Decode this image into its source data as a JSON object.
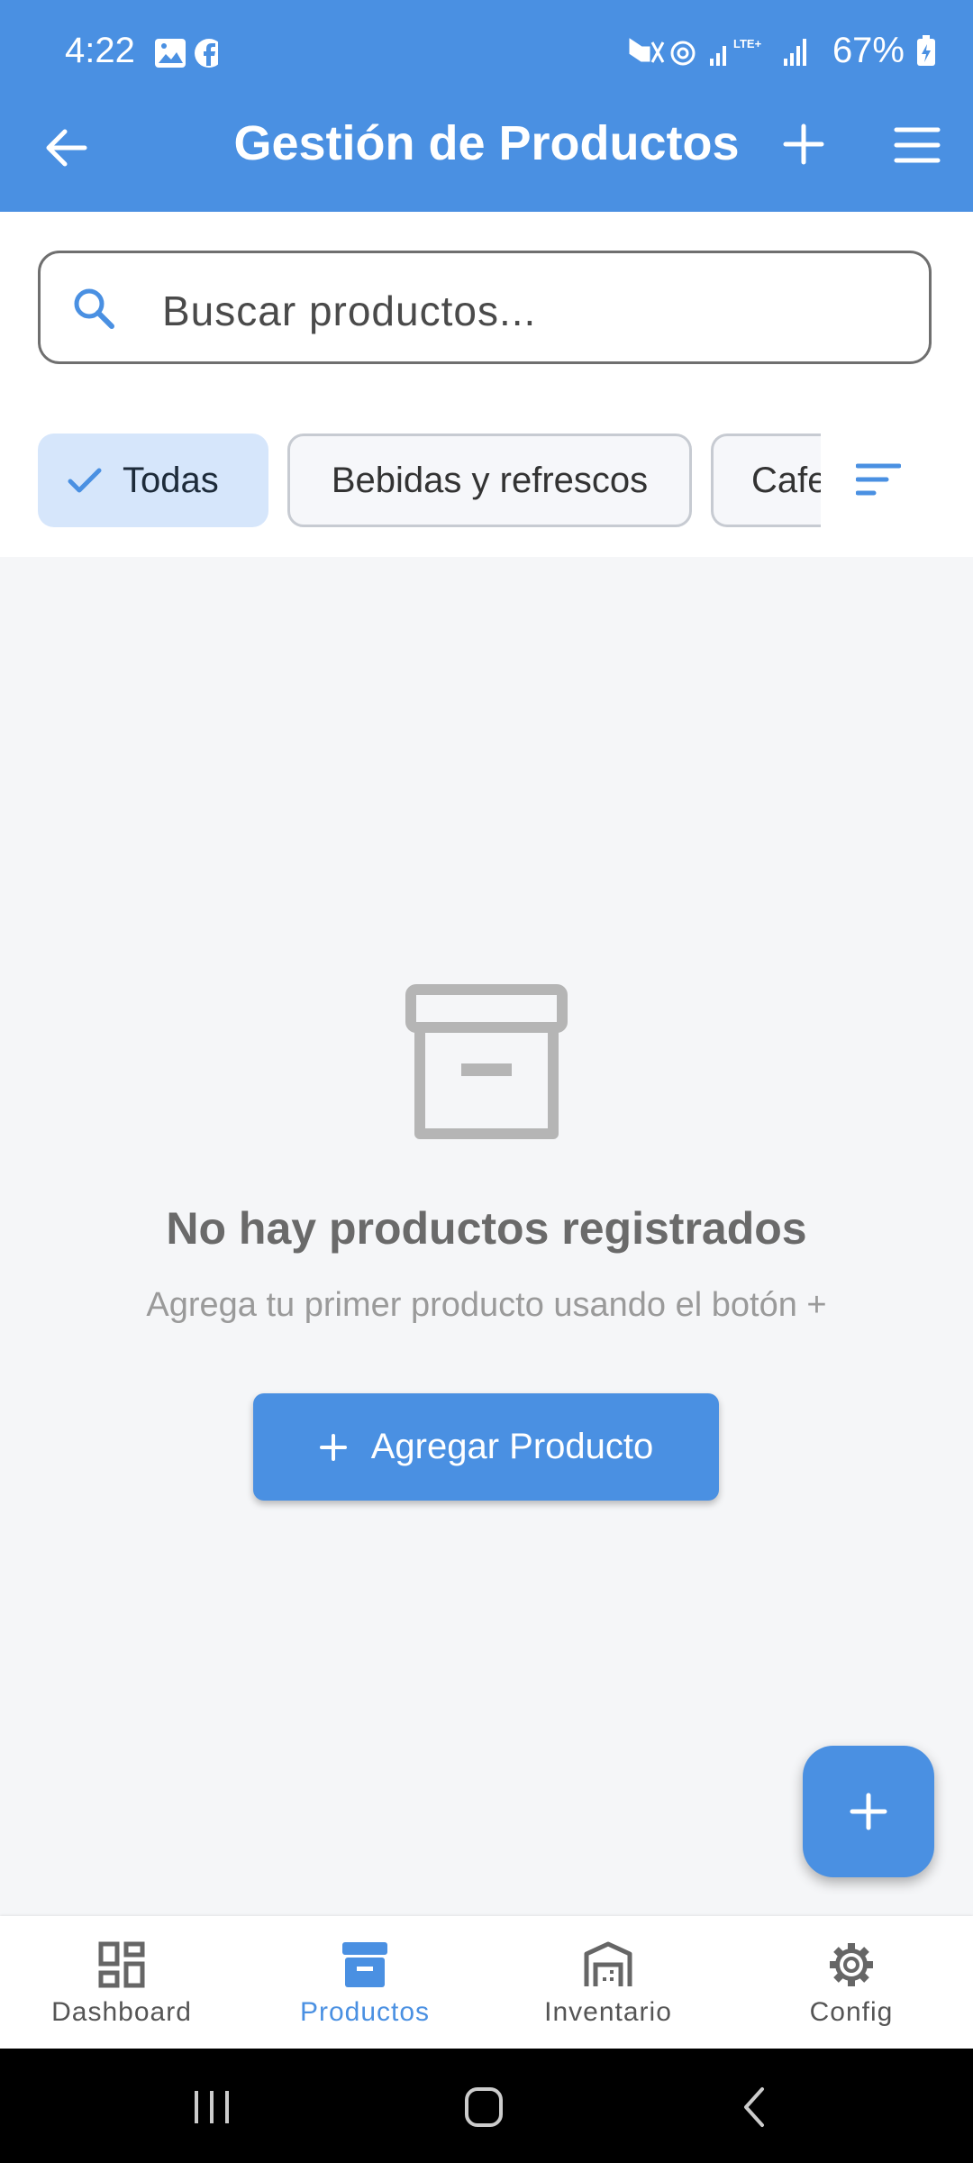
{
  "status_bar": {
    "time": "4:22",
    "battery": "67%"
  },
  "header": {
    "title": "Gestión de Productos"
  },
  "search": {
    "placeholder": "Buscar productos..."
  },
  "chips": [
    {
      "label": "Todas",
      "selected": true
    },
    {
      "label": "Bebidas y refrescos",
      "selected": false
    },
    {
      "label": "Cafe",
      "selected": false
    }
  ],
  "empty_state": {
    "title": "No hay productos registrados",
    "subtitle": "Agrega tu primer producto usando el botón +",
    "button_label": "Agregar Producto"
  },
  "bottom_nav": [
    {
      "label": "Dashboard",
      "icon": "dashboard-icon",
      "active": false
    },
    {
      "label": "Productos",
      "icon": "archive-box-icon",
      "active": true
    },
    {
      "label": "Inventario",
      "icon": "warehouse-icon",
      "active": false
    },
    {
      "label": "Config",
      "icon": "gear-icon",
      "active": false
    }
  ],
  "colors": {
    "primary": "#4a90e2",
    "chip_selected_bg": "#d6e6fb",
    "background": "#f5f6f8"
  }
}
